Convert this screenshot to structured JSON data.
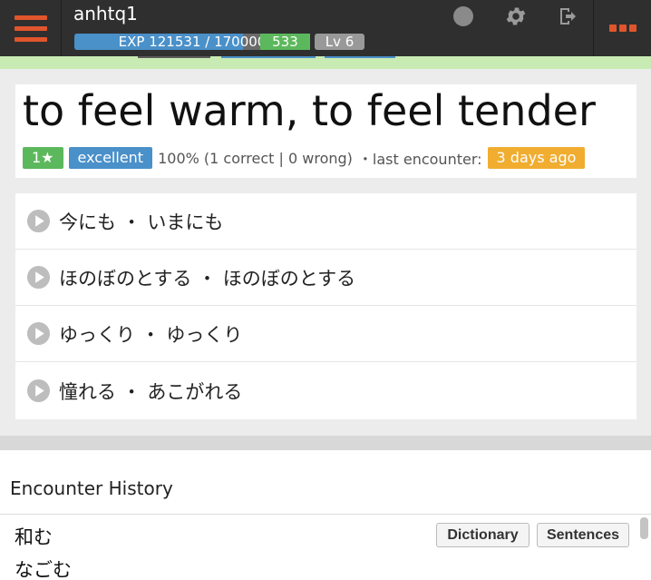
{
  "header": {
    "username": "anhtq1",
    "exp_label": "EXP 121531 / 170000",
    "exp_fraction": 0.715,
    "points": "533",
    "level": "Lv 6",
    "icons": [
      "hamburger-menu-icon",
      "status-circle-icon",
      "gear-icon",
      "logout-icon",
      "more-dots-icon"
    ],
    "accent_color": "#e0552c"
  },
  "definition": {
    "text": "to feel warm, to feel tender",
    "stars": "1★",
    "grade": "excellent",
    "accuracy": "100% (1 correct | 0 wrong)",
    "last_label": "・last encounter:",
    "last_value": "3 days ago"
  },
  "words": [
    {
      "text": "今にも ・ いまにも"
    },
    {
      "text": "ほのぼのとする ・ ほのぼのとする"
    },
    {
      "text": "ゆっくり ・ ゆっくり"
    },
    {
      "text": "憧れる ・ あこがれる"
    }
  ],
  "history": {
    "title": "Encounter History",
    "kanji": "和む",
    "kana": "なごむ",
    "dictionary_label": "Dictionary",
    "sentences_label": "Sentences"
  }
}
